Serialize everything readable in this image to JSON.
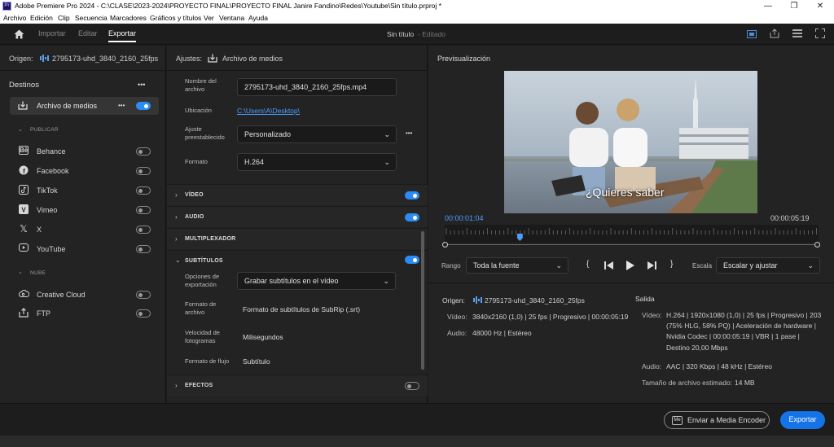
{
  "window": {
    "app_icon": "Pr",
    "title": "Adobe Premiere Pro 2024 - C:\\CLASE\\2023-2024\\PROYECTO FINAL\\PROYECTO FINAL Janire Fandino\\Redes\\Youtube\\Sin título.prproj *",
    "minimize": "—",
    "maximize": "❐",
    "close": "✕"
  },
  "menu": [
    "Archivo",
    "Edición",
    "Clip",
    "Secuencia",
    "Marcadores",
    "Gráficos y títulos",
    "Ver",
    "Ventana",
    "Ayuda"
  ],
  "header": {
    "tabs": [
      "Importar",
      "Editar",
      "Exportar"
    ],
    "active_tab": "Exportar",
    "project_name": "Sin título",
    "project_status": "- Editado"
  },
  "left": {
    "origin_label": "Origen:",
    "origin_value": "2795173-uhd_3840_2160_25fps",
    "destinations_title": "Destinos",
    "more": "•••",
    "media_file": "Archivo de medios",
    "publish_header": "PUBLICAR",
    "publish_items": [
      "Behance",
      "Facebook",
      "TikTok",
      "Vimeo",
      "X",
      "YouTube"
    ],
    "cloud_header": "NUBE",
    "cloud_items": [
      "Creative Cloud",
      "FTP"
    ]
  },
  "settings": {
    "title_label": "Ajustes:",
    "title_value": "Archivo de medios",
    "filename_label": "Nombre del archivo",
    "filename_value": "2795173-uhd_3840_2160_25fps.mp4",
    "location_label": "Ubicación",
    "location_value": "C:\\Users\\A\\Desktop\\",
    "preset_label": "Ajuste preestablecido",
    "preset_value": "Personalizado",
    "format_label": "Formato",
    "format_value": "H.264",
    "sections": {
      "video": "VÍDEO",
      "audio": "AUDIO",
      "mux": "MULTIPLEXADOR",
      "subtitles": "SUBTÍTULOS",
      "effects": "EFECTOS"
    },
    "export_options_label": "Opciones de exportación",
    "export_options_value": "Grabar subtítulos en el vídeo",
    "sub_format_label": "Formato de archivo",
    "sub_format_value": "Formato de subtítulos de SubRip (.srt)",
    "framerate_label": "Velocidad de fotogramas",
    "framerate_value": "Milisegundos",
    "stream_label": "Formato de flujo",
    "stream_value": "Subtítulo"
  },
  "preview": {
    "title": "Previsualización",
    "caption": "¿Quieres saber",
    "current_time": "00:00:01:04",
    "duration": "00:00:05:19",
    "playhead_fraction": 0.2,
    "range_label": "Rango",
    "range_value": "Toda la fuente",
    "scale_label": "Escala",
    "scale_value": "Escalar y ajustar"
  },
  "summary": {
    "source_title": "Origen:",
    "source_name": "2795173-uhd_3840_2160_25fps",
    "source_video_label": "Vídeo:",
    "source_video_value": "3840x2160 (1,0)  |  25 fps  |  Progresivo  |  00:00:05:19",
    "source_audio_label": "Audio:",
    "source_audio_value": "48000 Hz  |  Estéreo",
    "output_title": "Salida",
    "output_video_label": "Vídeo:",
    "output_video_lines": [
      "H.264  |  1920x1080 (1,0)  |  25 fps  |  Progresivo  |  203",
      "(75% HLG, 58% PQ)  |  Aceleración de hardware  |",
      "Nvidia Codec  |  00:00:05:19  |  VBR  |  1 pase  |",
      "Destino 20,00 Mbps"
    ],
    "output_audio_label": "Audio:",
    "output_audio_value": "AAC  |  320 Kbps  |  48 kHz  |  Estéreo",
    "filesize_label": "Tamaño de archivo estimado:",
    "filesize_value": "14 MB"
  },
  "footer": {
    "media_encoder_icon": "Me",
    "media_encoder": "Enviar a Media Encoder",
    "export": "Exportar"
  },
  "colors": {
    "accent": "#2c8cf4",
    "panel": "#232323",
    "background": "#1d1d1d"
  }
}
